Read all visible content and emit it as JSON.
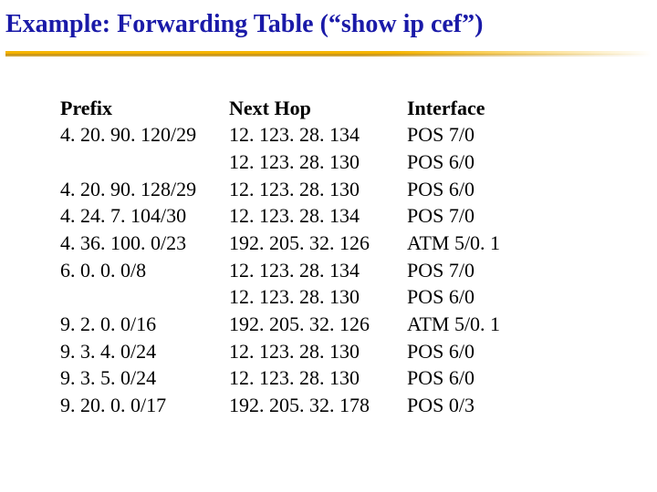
{
  "title": "Example: Forwarding Table (“show ip cef”)",
  "headers": {
    "prefix": "Prefix",
    "nexthop": "Next Hop",
    "interface": "Interface"
  },
  "prefix_col": [
    "4. 20. 90. 120/29",
    "",
    "4. 20. 90. 128/29",
    "4. 24. 7. 104/30",
    "4. 36. 100. 0/23",
    "6. 0. 0. 0/8",
    "",
    "9. 2. 0. 0/16",
    "9. 3. 4. 0/24",
    "9. 3. 5. 0/24",
    "9. 20. 0. 0/17"
  ],
  "nexthop_col": [
    "12. 123. 28. 134",
    "12. 123. 28. 130",
    "12. 123. 28. 130",
    "12. 123. 28. 134",
    "192. 205. 32. 126",
    "12. 123. 28. 134",
    "12. 123. 28. 130",
    "192. 205. 32. 126",
    "12. 123. 28. 130",
    "12. 123. 28. 130",
    "192. 205. 32. 178"
  ],
  "interface_col": [
    "POS 7/0",
    "POS 6/0",
    "POS 6/0",
    "POS 7/0",
    "ATM 5/0. 1",
    "POS 7/0",
    "POS 6/0",
    "ATM 5/0. 1",
    "POS 6/0",
    "POS 6/0",
    "POS 0/3"
  ]
}
